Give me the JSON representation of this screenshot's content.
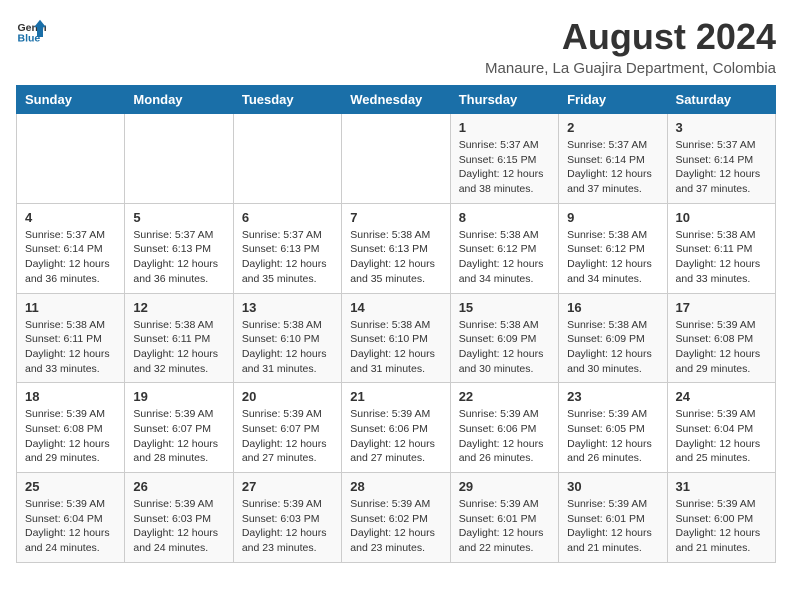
{
  "header": {
    "logo_general": "General",
    "logo_blue": "Blue",
    "month_year": "August 2024",
    "location": "Manaure, La Guajira Department, Colombia"
  },
  "weekdays": [
    "Sunday",
    "Monday",
    "Tuesday",
    "Wednesday",
    "Thursday",
    "Friday",
    "Saturday"
  ],
  "weeks": [
    [
      {
        "day": "",
        "info": ""
      },
      {
        "day": "",
        "info": ""
      },
      {
        "day": "",
        "info": ""
      },
      {
        "day": "",
        "info": ""
      },
      {
        "day": "1",
        "info": "Sunrise: 5:37 AM\nSunset: 6:15 PM\nDaylight: 12 hours\nand 38 minutes."
      },
      {
        "day": "2",
        "info": "Sunrise: 5:37 AM\nSunset: 6:14 PM\nDaylight: 12 hours\nand 37 minutes."
      },
      {
        "day": "3",
        "info": "Sunrise: 5:37 AM\nSunset: 6:14 PM\nDaylight: 12 hours\nand 37 minutes."
      }
    ],
    [
      {
        "day": "4",
        "info": "Sunrise: 5:37 AM\nSunset: 6:14 PM\nDaylight: 12 hours\nand 36 minutes."
      },
      {
        "day": "5",
        "info": "Sunrise: 5:37 AM\nSunset: 6:13 PM\nDaylight: 12 hours\nand 36 minutes."
      },
      {
        "day": "6",
        "info": "Sunrise: 5:37 AM\nSunset: 6:13 PM\nDaylight: 12 hours\nand 35 minutes."
      },
      {
        "day": "7",
        "info": "Sunrise: 5:38 AM\nSunset: 6:13 PM\nDaylight: 12 hours\nand 35 minutes."
      },
      {
        "day": "8",
        "info": "Sunrise: 5:38 AM\nSunset: 6:12 PM\nDaylight: 12 hours\nand 34 minutes."
      },
      {
        "day": "9",
        "info": "Sunrise: 5:38 AM\nSunset: 6:12 PM\nDaylight: 12 hours\nand 34 minutes."
      },
      {
        "day": "10",
        "info": "Sunrise: 5:38 AM\nSunset: 6:11 PM\nDaylight: 12 hours\nand 33 minutes."
      }
    ],
    [
      {
        "day": "11",
        "info": "Sunrise: 5:38 AM\nSunset: 6:11 PM\nDaylight: 12 hours\nand 33 minutes."
      },
      {
        "day": "12",
        "info": "Sunrise: 5:38 AM\nSunset: 6:11 PM\nDaylight: 12 hours\nand 32 minutes."
      },
      {
        "day": "13",
        "info": "Sunrise: 5:38 AM\nSunset: 6:10 PM\nDaylight: 12 hours\nand 31 minutes."
      },
      {
        "day": "14",
        "info": "Sunrise: 5:38 AM\nSunset: 6:10 PM\nDaylight: 12 hours\nand 31 minutes."
      },
      {
        "day": "15",
        "info": "Sunrise: 5:38 AM\nSunset: 6:09 PM\nDaylight: 12 hours\nand 30 minutes."
      },
      {
        "day": "16",
        "info": "Sunrise: 5:38 AM\nSunset: 6:09 PM\nDaylight: 12 hours\nand 30 minutes."
      },
      {
        "day": "17",
        "info": "Sunrise: 5:39 AM\nSunset: 6:08 PM\nDaylight: 12 hours\nand 29 minutes."
      }
    ],
    [
      {
        "day": "18",
        "info": "Sunrise: 5:39 AM\nSunset: 6:08 PM\nDaylight: 12 hours\nand 29 minutes."
      },
      {
        "day": "19",
        "info": "Sunrise: 5:39 AM\nSunset: 6:07 PM\nDaylight: 12 hours\nand 28 minutes."
      },
      {
        "day": "20",
        "info": "Sunrise: 5:39 AM\nSunset: 6:07 PM\nDaylight: 12 hours\nand 27 minutes."
      },
      {
        "day": "21",
        "info": "Sunrise: 5:39 AM\nSunset: 6:06 PM\nDaylight: 12 hours\nand 27 minutes."
      },
      {
        "day": "22",
        "info": "Sunrise: 5:39 AM\nSunset: 6:06 PM\nDaylight: 12 hours\nand 26 minutes."
      },
      {
        "day": "23",
        "info": "Sunrise: 5:39 AM\nSunset: 6:05 PM\nDaylight: 12 hours\nand 26 minutes."
      },
      {
        "day": "24",
        "info": "Sunrise: 5:39 AM\nSunset: 6:04 PM\nDaylight: 12 hours\nand 25 minutes."
      }
    ],
    [
      {
        "day": "25",
        "info": "Sunrise: 5:39 AM\nSunset: 6:04 PM\nDaylight: 12 hours\nand 24 minutes."
      },
      {
        "day": "26",
        "info": "Sunrise: 5:39 AM\nSunset: 6:03 PM\nDaylight: 12 hours\nand 24 minutes."
      },
      {
        "day": "27",
        "info": "Sunrise: 5:39 AM\nSunset: 6:03 PM\nDaylight: 12 hours\nand 23 minutes."
      },
      {
        "day": "28",
        "info": "Sunrise: 5:39 AM\nSunset: 6:02 PM\nDaylight: 12 hours\nand 23 minutes."
      },
      {
        "day": "29",
        "info": "Sunrise: 5:39 AM\nSunset: 6:01 PM\nDaylight: 12 hours\nand 22 minutes."
      },
      {
        "day": "30",
        "info": "Sunrise: 5:39 AM\nSunset: 6:01 PM\nDaylight: 12 hours\nand 21 minutes."
      },
      {
        "day": "31",
        "info": "Sunrise: 5:39 AM\nSunset: 6:00 PM\nDaylight: 12 hours\nand 21 minutes."
      }
    ]
  ]
}
